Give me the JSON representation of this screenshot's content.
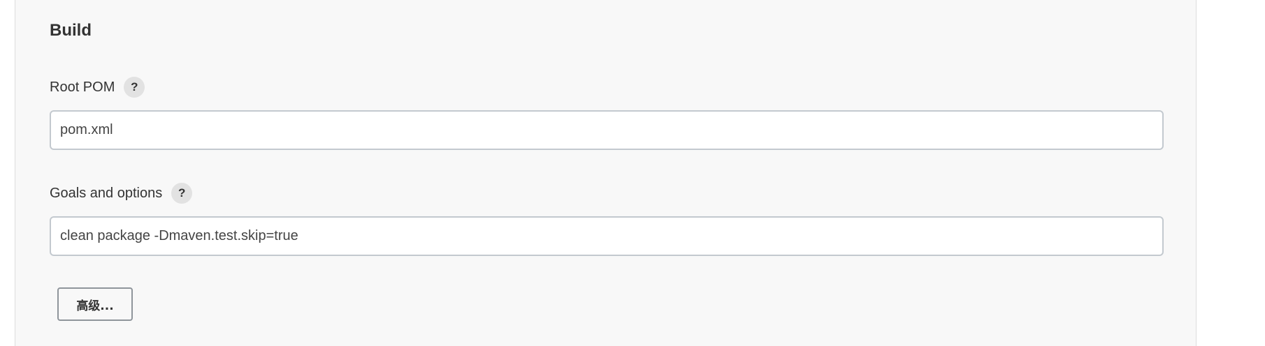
{
  "build": {
    "title": "Build",
    "root_pom": {
      "label": "Root POM",
      "help": "?",
      "value": "pom.xml"
    },
    "goals": {
      "label": "Goals and options",
      "help": "?",
      "value": "clean package -Dmaven.test.skip=true"
    },
    "advanced_button": "高级..."
  }
}
